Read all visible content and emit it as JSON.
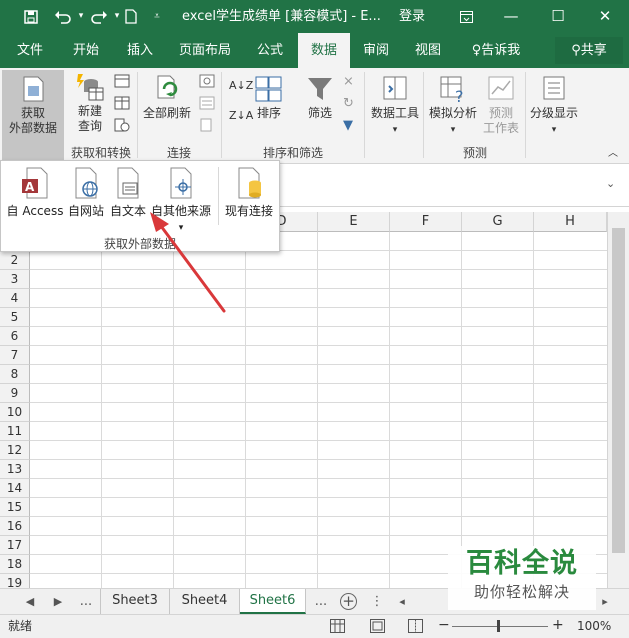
{
  "window": {
    "title": "excel学生成绩单  [兼容模式]  -  E...",
    "login": "登录",
    "qat_icons": [
      "save-icon",
      "undo-icon",
      "redo-icon",
      "new-file-icon",
      "customize-qat-icon"
    ],
    "controls": [
      "ribbon-display-icon",
      "minimize-icon",
      "maximize-icon",
      "close-icon"
    ]
  },
  "menu": {
    "tabs": [
      "文件",
      "开始",
      "插入",
      "页面布局",
      "公式",
      "数据",
      "审阅",
      "视图",
      "告诉我"
    ],
    "active": "数据",
    "share": "共享"
  },
  "ribbon": {
    "get_external": "获取\n外部数据",
    "new_query": "新建\n查询",
    "refresh_all": "全部刷新",
    "sort": "排序",
    "filter": "筛选",
    "data_tools": "数据工具",
    "what_if": "模拟分析",
    "forecast_sheet": "预测\n工作表",
    "outline": "分级显示",
    "groups": {
      "get_transform": "获取和转换",
      "connections": "连接",
      "sort_filter": "排序和筛选",
      "forecast": "预测"
    }
  },
  "dropdown": {
    "items": [
      "自 Access",
      "自网站",
      "自文本",
      "自其他来源",
      "现有连接"
    ],
    "group_label": "获取外部数据"
  },
  "grid": {
    "columns": [
      "D",
      "E",
      "F",
      "G",
      "H"
    ],
    "rows": [
      "2",
      "3",
      "4",
      "5",
      "6",
      "7",
      "8",
      "9",
      "10",
      "11",
      "12",
      "13",
      "14",
      "15",
      "16",
      "17",
      "18",
      "19"
    ]
  },
  "sheets": {
    "tabs": [
      "Sheet3",
      "Sheet4",
      "Sheet6"
    ],
    "active": "Sheet6",
    "ellipsis": "..."
  },
  "status": {
    "ready": "就绪",
    "zoom": "100%"
  },
  "watermark": {
    "main": "百科全说",
    "sub": "助你轻松解决"
  },
  "colors": {
    "accent": "#217346",
    "arrow": "#d9383a"
  }
}
